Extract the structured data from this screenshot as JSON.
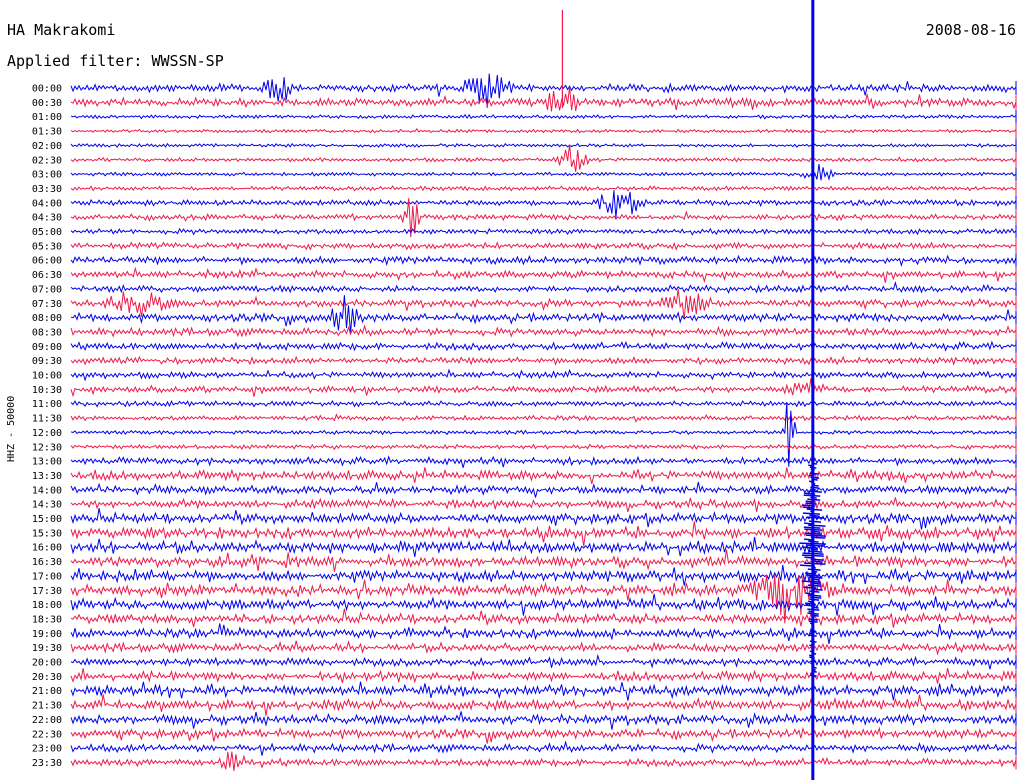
{
  "header": {
    "station": "HA Makrakomi",
    "date": "2008-08-16",
    "filter_text": "Applied filter: WWSSN-SP"
  },
  "chart_data": {
    "type": "line",
    "title": "HA Makrakomi",
    "subtitle": "Applied filter: WWSSN-SP",
    "ylabel": "HHZ - 50000",
    "row_labels": [
      "00:00",
      "00:30",
      "01:00",
      "01:30",
      "02:00",
      "02:30",
      "03:00",
      "03:30",
      "04:00",
      "04:30",
      "05:00",
      "05:30",
      "06:00",
      "06:30",
      "07:00",
      "07:30",
      "08:00",
      "08:30",
      "09:00",
      "09:30",
      "10:00",
      "10:30",
      "11:00",
      "11:30",
      "12:00",
      "12:30",
      "13:00",
      "13:30",
      "14:00",
      "14:30",
      "15:00",
      "15:30",
      "16:00",
      "16:30",
      "17:00",
      "17:30",
      "18:00",
      "18:30",
      "19:00",
      "19:30",
      "20:00",
      "20:30",
      "21:00",
      "21:30",
      "22:00",
      "22:30",
      "23:00",
      "23:30"
    ],
    "trace_colors": [
      "#0000ee",
      "#ee1a4a"
    ],
    "row_activity": [
      0.55,
      0.6,
      0.12,
      0.08,
      0.1,
      0.15,
      0.12,
      0.2,
      0.35,
      0.35,
      0.3,
      0.4,
      0.5,
      0.5,
      0.45,
      0.55,
      0.6,
      0.55,
      0.5,
      0.45,
      0.4,
      0.45,
      0.3,
      0.25,
      0.15,
      0.2,
      0.5,
      0.7,
      0.6,
      0.65,
      0.8,
      0.9,
      1.0,
      0.95,
      0.85,
      0.85,
      0.9,
      0.8,
      0.7,
      0.65,
      0.55,
      0.7,
      0.8,
      0.85,
      0.8,
      0.7,
      0.55,
      0.5
    ],
    "events": [
      {
        "row": 0,
        "x": 0.22,
        "amp": 14,
        "dur": 0.02
      },
      {
        "row": 0,
        "x": 0.44,
        "amp": 18,
        "dur": 0.03
      },
      {
        "row": 1,
        "x": 0.52,
        "amp": 22,
        "dur": 0.02
      },
      {
        "row": 5,
        "x": 0.53,
        "amp": 16,
        "dur": 0.02
      },
      {
        "row": 6,
        "x": 0.79,
        "amp": 10,
        "dur": 0.02
      },
      {
        "row": 8,
        "x": 0.58,
        "amp": 14,
        "dur": 0.03
      },
      {
        "row": 9,
        "x": 0.36,
        "amp": 28,
        "dur": 0.01
      },
      {
        "row": 15,
        "x": 0.07,
        "amp": 14,
        "dur": 0.04
      },
      {
        "row": 15,
        "x": 0.65,
        "amp": 14,
        "dur": 0.03
      },
      {
        "row": 16,
        "x": 0.29,
        "amp": 20,
        "dur": 0.02
      },
      {
        "row": 21,
        "x": 0.78,
        "amp": 10,
        "dur": 0.03
      },
      {
        "row": 24,
        "x": 0.76,
        "amp": 40,
        "dur": 0.01
      },
      {
        "row": 35,
        "x": 0.76,
        "amp": 30,
        "dur": 0.05
      },
      {
        "row": 47,
        "x": 0.17,
        "amp": 12,
        "dur": 0.02
      }
    ],
    "big_spike_x": 0.785,
    "grid": false
  }
}
